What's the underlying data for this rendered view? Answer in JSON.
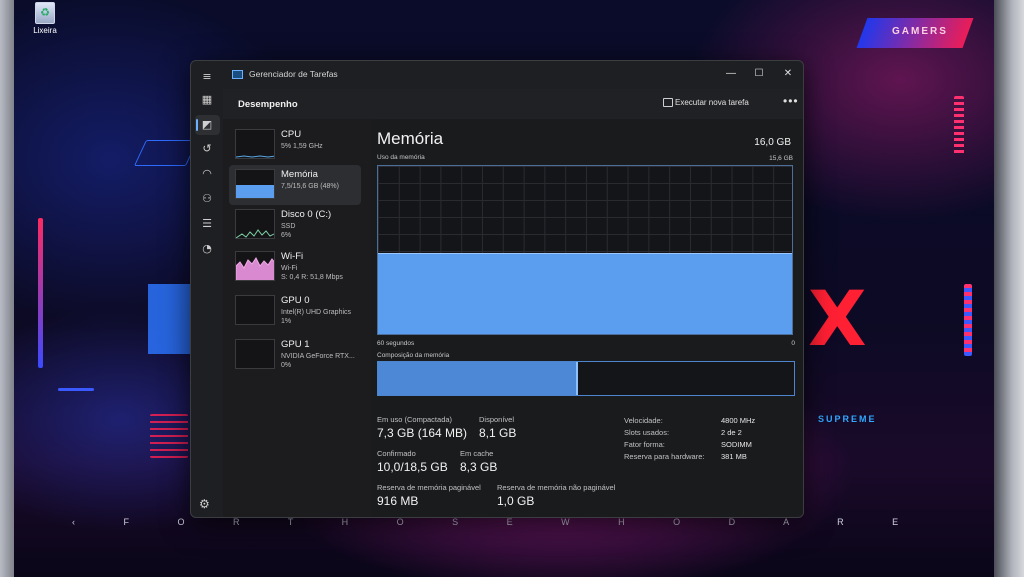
{
  "desktop": {
    "recycle_bin_label": "Lixeira",
    "badge_text": "GAMERS",
    "tagline": "SUPREME",
    "footer_strip": "‹ F O R T H O S E W H O D A R E ›"
  },
  "window": {
    "title": "Gerenciador de Tarefas",
    "controls": {
      "minimize": "—",
      "maximize": "☐",
      "close": "✕"
    }
  },
  "header": {
    "section_title": "Desempenho",
    "run_task_label": "Executar nova tarefa",
    "more_label": "•••"
  },
  "sidebar": {
    "items": [
      {
        "name": "CPU",
        "lines": [
          "5% 1,59 GHz"
        ]
      },
      {
        "name": "Memória",
        "lines": [
          "7,5/15,6 GB (48%)"
        ]
      },
      {
        "name": "Disco 0 (C:)",
        "lines": [
          "SSD",
          "6%"
        ]
      },
      {
        "name": "Wi-Fi",
        "lines": [
          "Wi-Fi",
          "S: 0,4 R: 51,8 Mbps"
        ]
      },
      {
        "name": "GPU 0",
        "lines": [
          "Intel(R) UHD Graphics",
          "1%"
        ]
      },
      {
        "name": "GPU 1",
        "lines": [
          "NVIDIA GeForce RTX...",
          "0%"
        ]
      }
    ]
  },
  "memory": {
    "title": "Memória",
    "total": "16,0 GB",
    "usage_label": "Uso da memória",
    "graph_max": "15,6 GB",
    "time_left": "60 segundos",
    "time_right": "0",
    "usage_fraction": 0.48,
    "composition_label": "Composição da memória",
    "composition_used_fraction": 0.48,
    "stats": {
      "in_use_label": "Em uso (Compactada)",
      "in_use_value": "7,3 GB (164 MB)",
      "available_label": "Disponível",
      "available_value": "8,1 GB",
      "committed_label": "Confirmado",
      "committed_value": "10,0/18,5 GB",
      "cached_label": "Em cache",
      "cached_value": "8,3 GB",
      "paged_label": "Reserva de memória paginável",
      "paged_value": "916 MB",
      "nonpaged_label": "Reserva de memória não paginável",
      "nonpaged_value": "1,0 GB"
    },
    "details": [
      {
        "key": "Velocidade:",
        "value": "4800 MHz"
      },
      {
        "key": "Slots usados:",
        "value": "2 de 2"
      },
      {
        "key": "Fator forma:",
        "value": "SODIMM"
      },
      {
        "key": "Reserva para hardware:",
        "value": "381 MB"
      }
    ]
  },
  "colors": {
    "accent": "#5b9ef0",
    "window_bg": "#1e1f22",
    "selection": "#2d2e32"
  }
}
